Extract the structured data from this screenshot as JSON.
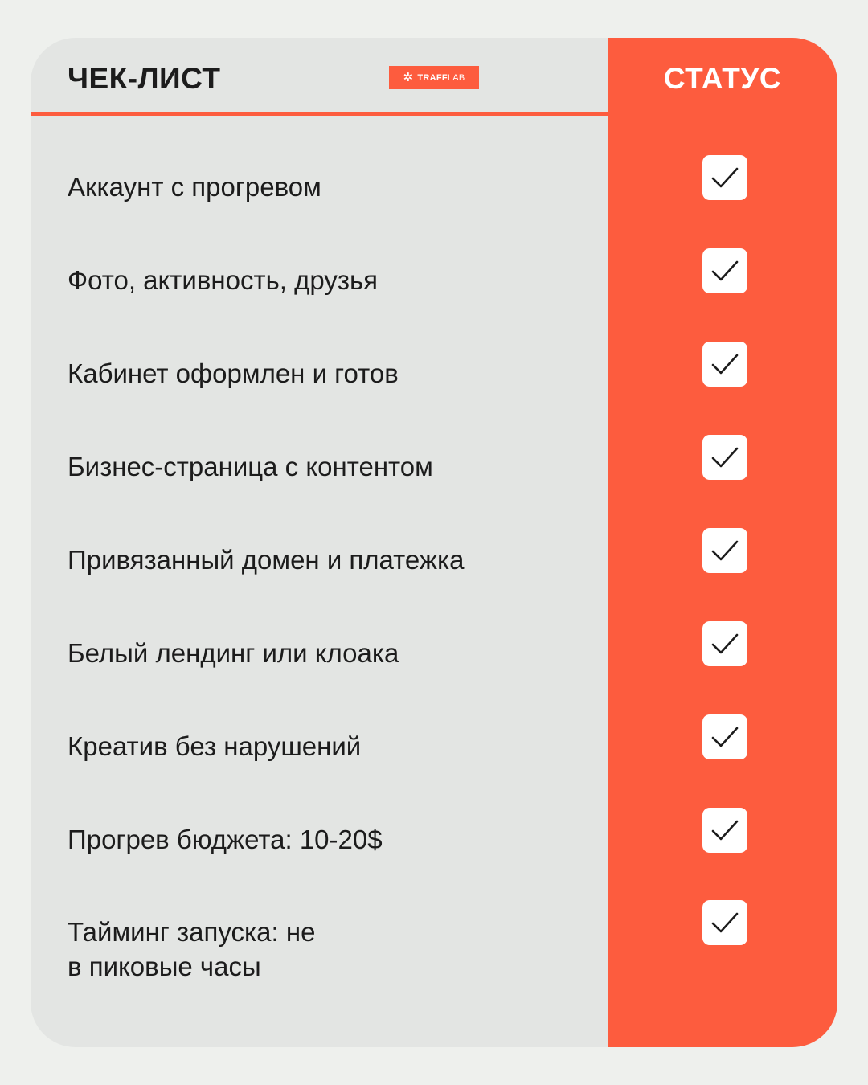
{
  "header": {
    "title": "ЧЕК-ЛИСТ",
    "status_title": "СТАТУС"
  },
  "logo": {
    "mark": "✲",
    "bold": "TRAFF",
    "light": "LAB"
  },
  "items": [
    {
      "label": "Аккаунт с прогревом",
      "checked": true
    },
    {
      "label": "Фото, активность, друзья",
      "checked": true
    },
    {
      "label": "Кабинет оформлен и готов",
      "checked": true
    },
    {
      "label": "Бизнес-страница с контентом",
      "checked": true
    },
    {
      "label": "Привязанный домен и платежка",
      "checked": true
    },
    {
      "label": "Белый лендинг или клоака",
      "checked": true
    },
    {
      "label": "Креатив без нарушений",
      "checked": true
    },
    {
      "label": "Прогрев бюджета: 10-20$",
      "checked": true
    },
    {
      "label": "Тайминг запуска: не\nв пиковые часы",
      "checked": true
    }
  ],
  "colors": {
    "accent": "#fd5c3e",
    "card": "#e3e5e3",
    "background": "#eef0ed",
    "text": "#1c1c1c"
  }
}
